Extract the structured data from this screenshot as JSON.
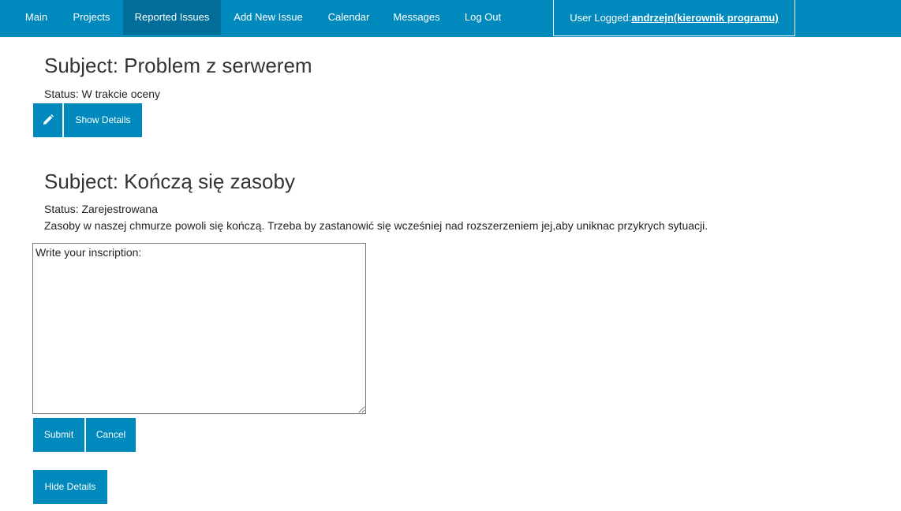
{
  "nav": {
    "items": [
      {
        "label": "Main"
      },
      {
        "label": "Projects"
      },
      {
        "label": "Reported Issues"
      },
      {
        "label": "Add New Issue"
      },
      {
        "label": "Calendar"
      },
      {
        "label": "Messages"
      },
      {
        "label": "Log Out"
      }
    ],
    "active": "Reported Issues",
    "user_prefix": "User Logged:",
    "user_name": "andrzejn(kierownik programu)"
  },
  "issues": [
    {
      "subject": "Subject: Problem z serwerem",
      "status": "Status: W trakcie oceny",
      "show_details_label": "Show Details"
    },
    {
      "subject": "Subject: Kończą się zasoby",
      "status": "Status: Zarejestrowana",
      "description": "Zasoby w naszej chmurze powoli się kończą. Trzeba by zastanowić się wcześniej nad rozszerzeniem jej,aby uniknac przykrych sytuacji.",
      "inscription_placeholder": "Write your inscription:",
      "submit_label": "Submit",
      "cancel_label": "Cancel",
      "hide_details_label": "Hide Details"
    }
  ],
  "colors": {
    "primary": "#0089bd",
    "active_nav": "#006e98"
  },
  "icons": {
    "edit": "pencil-icon"
  }
}
